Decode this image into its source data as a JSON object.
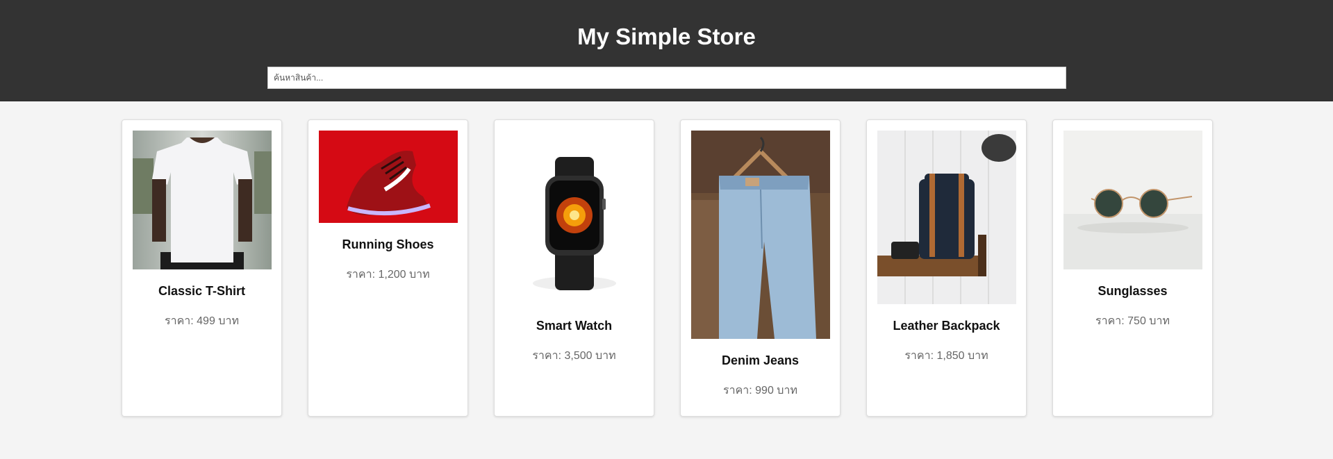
{
  "header": {
    "title": "My Simple Store",
    "search_placeholder": "ค้นหาสินค้า..."
  },
  "products": [
    {
      "name": "Classic T-Shirt",
      "price": "ราคา: 499 บาท",
      "image": "white t-shirt on model"
    },
    {
      "name": "Running Shoes",
      "price": "ราคา: 1,200 บาท",
      "image": "red running shoe"
    },
    {
      "name": "Smart Watch",
      "price": "ราคา: 3,500 บาท",
      "image": "black smart watch"
    },
    {
      "name": "Denim Jeans",
      "price": "ราคา: 990 บาท",
      "image": "jeans on hanger"
    },
    {
      "name": "Leather Backpack",
      "price": "ราคา: 1,850 บาท",
      "image": "black leather backpack"
    },
    {
      "name": "Sunglasses",
      "price": "ราคา: 750 บาท",
      "image": "round sunglasses"
    }
  ],
  "colors": {
    "header_bg": "#333333",
    "page_bg": "#f4f4f4",
    "price_text": "#666666"
  }
}
